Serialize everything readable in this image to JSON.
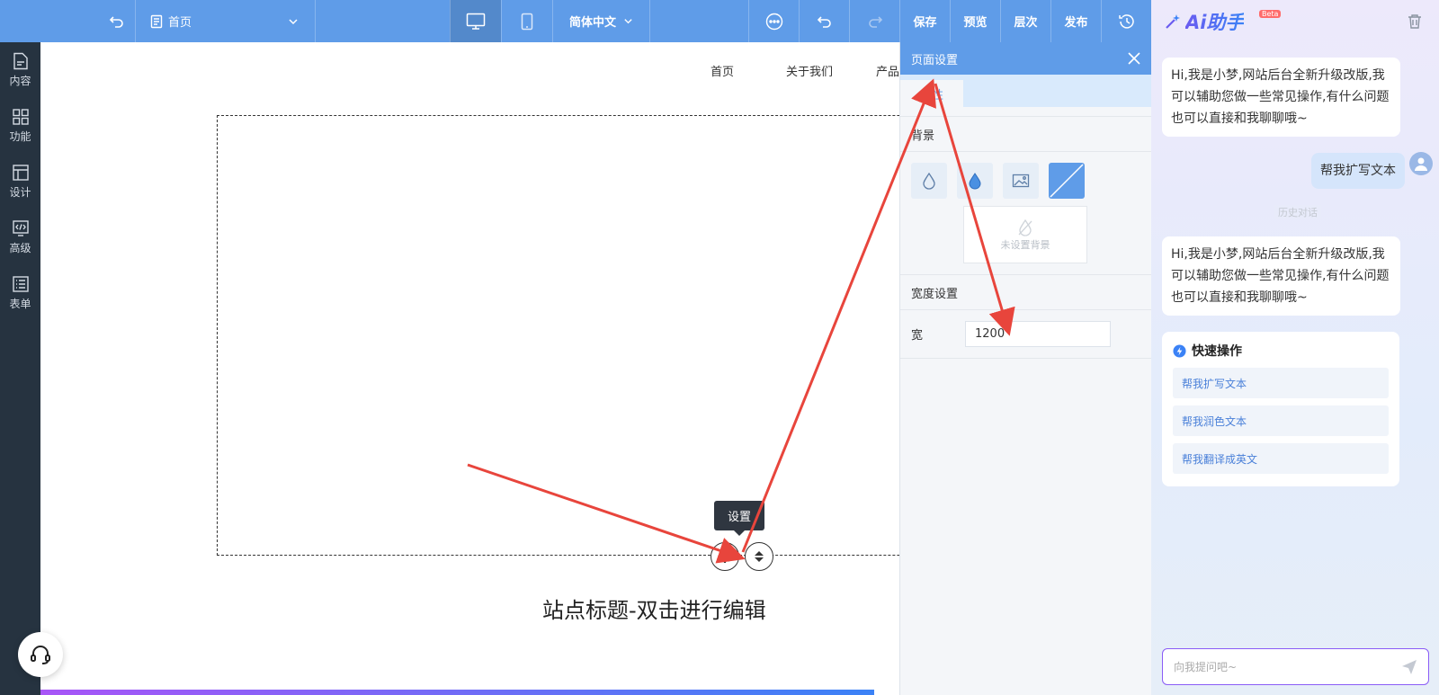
{
  "topbar": {
    "page_select": "首页",
    "language": "简体中文",
    "save": "保存",
    "preview": "预览",
    "layers": "层次",
    "publish": "发布"
  },
  "sidebar": {
    "items": [
      {
        "label": "内容",
        "icon": "file-icon"
      },
      {
        "label": "功能",
        "icon": "grid-icon"
      },
      {
        "label": "设计",
        "icon": "layout-icon"
      },
      {
        "label": "高级",
        "icon": "code-icon"
      },
      {
        "label": "表单",
        "icon": "form-icon"
      }
    ]
  },
  "canvas": {
    "nav": [
      "首页",
      "关于我们",
      "产品"
    ],
    "site_title": "站点标题-双击进行编辑",
    "tooltip": "设置"
  },
  "panel": {
    "title": "页面设置",
    "tab": "属性",
    "background_section": "背景",
    "no_background": "未设置背景",
    "width_section": "宽度设置",
    "width_label": "宽",
    "width_value": "1200"
  },
  "ai": {
    "title": "Ai助手",
    "beta": "Beta",
    "greeting1": "Hi,我是小梦,网站后台全新升级改版,我可以辅助您做一些常见操作,有什么问题也可以直接和我聊聊哦~",
    "user_msg": "帮我扩写文本",
    "history_divider": "历史对话",
    "greeting2": "Hi,我是小梦,网站后台全新升级改版,我可以辅助您做一些常见操作,有什么问题也可以直接和我聊聊哦~",
    "quick_title": "快速操作",
    "quick_items": [
      "帮我扩写文本",
      "帮我润色文本",
      "帮我翻译成英文"
    ],
    "input_placeholder": "向我提问吧~"
  },
  "colors": {
    "topbar": "#5f9ce8",
    "sidebar": "#263340",
    "annotation_arrow": "#e8453c"
  }
}
